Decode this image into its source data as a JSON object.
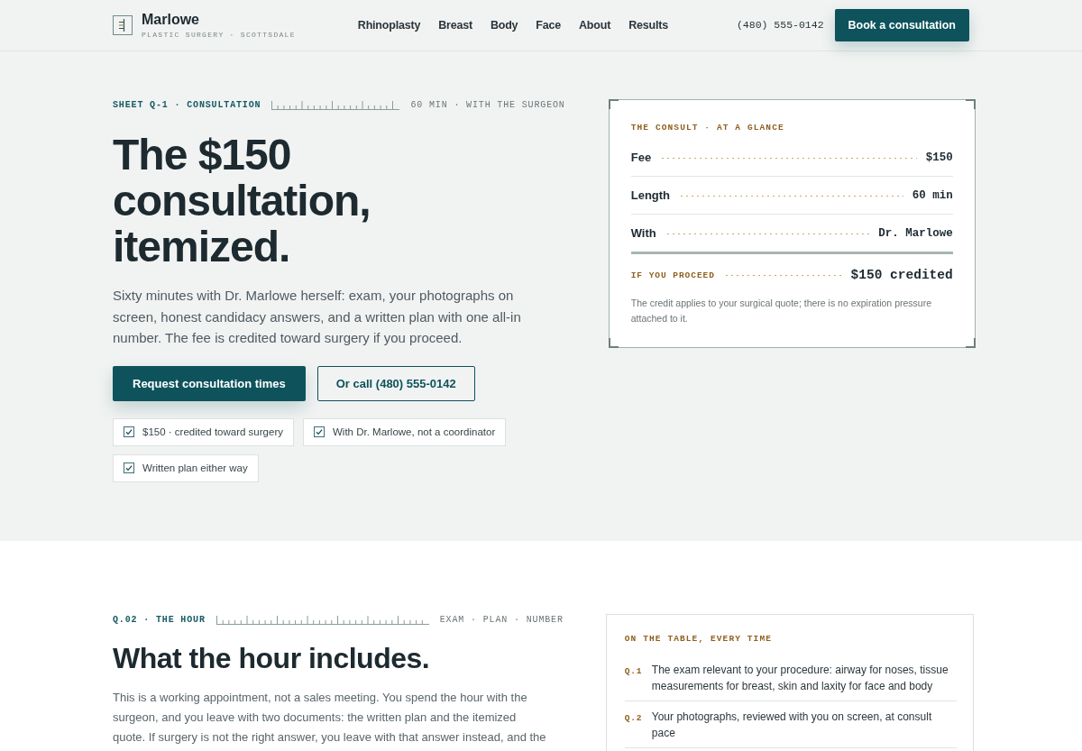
{
  "header": {
    "brand": {
      "name": "Marlowe",
      "tagline": "PLASTIC SURGERY · SCOTTSDALE"
    },
    "nav": [
      {
        "label": "Rhinoplasty"
      },
      {
        "label": "Breast"
      },
      {
        "label": "Body"
      },
      {
        "label": "Face"
      },
      {
        "label": "About"
      },
      {
        "label": "Results"
      }
    ],
    "phone": "(480) 555-0142",
    "cta": "Book a consultation"
  },
  "hero": {
    "eyebrow": {
      "label": "SHEET Q-1 · CONSULTATION",
      "note": "60 MIN · WITH THE SURGEON"
    },
    "title": "The $150 consultation, itemized.",
    "intro": "Sixty minutes with Dr. Marlowe herself: exam, your photographs on screen, honest candidacy answers, and a written plan with one all-in number. The fee is credited toward surgery if you proceed.",
    "buttons": [
      {
        "kind": "primary",
        "label": "Request consultation times"
      },
      {
        "kind": "outline",
        "label": "Or call (480) 555-0142"
      }
    ],
    "highlights": [
      {
        "label": "$150 · credited toward surgery",
        "checked": true
      },
      {
        "label": "With Dr. Marlowe, not a coordinator",
        "checked": true
      },
      {
        "label": "Written plan either way",
        "checked": true
      }
    ],
    "glance": {
      "title": "THE CONSULT · AT A GLANCE",
      "rows": [
        {
          "label": "Fee",
          "value": "$150"
        },
        {
          "label": "Length",
          "value": "60 min"
        },
        {
          "label": "With",
          "value": "Dr. Marlowe"
        }
      ],
      "total": {
        "label": "IF YOU PROCEED",
        "value": "$150 credited"
      },
      "note": "The credit applies to your surgical quote; there is no expiration pressure attached to it."
    }
  },
  "hour": {
    "eyebrow": {
      "label": "Q.02 · THE HOUR",
      "note": "EXAM · PLAN · NUMBER"
    },
    "title": "What the hour includes.",
    "intro": "This is a working appointment, not a sales meeting. You spend the hour with the surgeon, and you leave with two documents: the written plan and the itemized quote. If surgery is not the right answer, you leave with that answer instead, and the",
    "list": {
      "title": "ON THE TABLE, EVERY TIME",
      "items": [
        {
          "marker": "Q.1",
          "text": "The exam relevant to your procedure: airway for noses, tissue measurements for breast, skin and laxity for face and body"
        },
        {
          "marker": "Q.2",
          "text": "Your photographs, reviewed with you on screen, at consult pace"
        }
      ]
    }
  }
}
